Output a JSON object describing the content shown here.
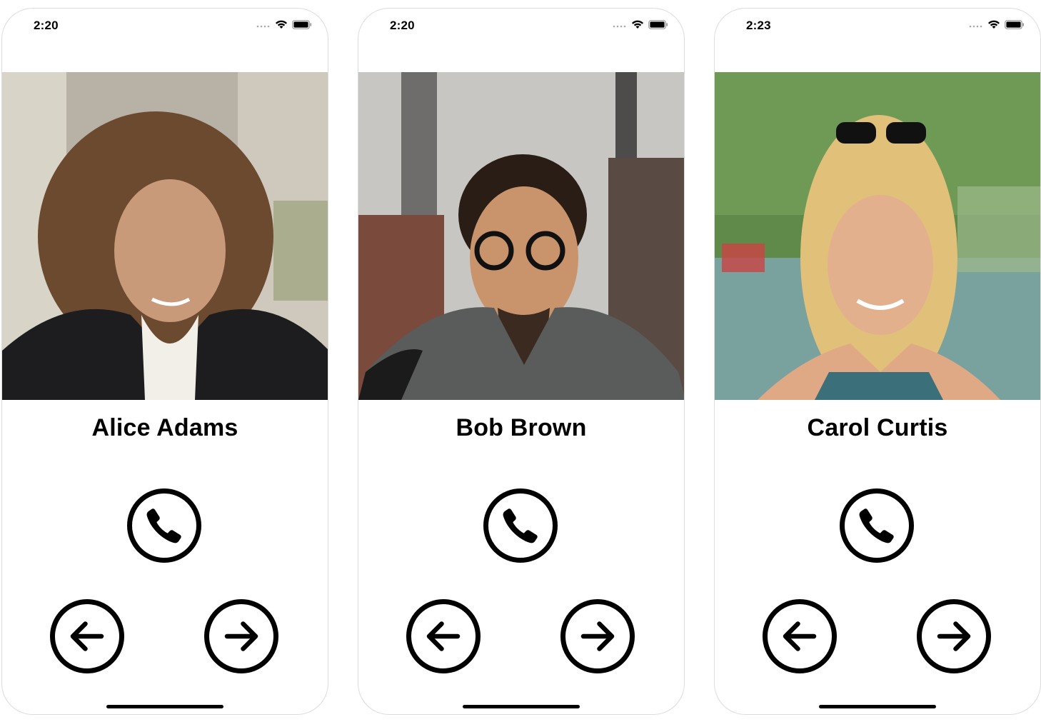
{
  "screens": [
    {
      "status_time": "2:20",
      "contact_name": "Alice Adams",
      "photo_palette": {
        "bg": "#b8b2a6",
        "bg2": "#d9d4c8",
        "skin": "#c99a7a",
        "hair": "#6b4a30",
        "clothing": "#1d1d1f",
        "accent": "#f2efe9"
      }
    },
    {
      "status_time": "2:20",
      "contact_name": "Bob Brown",
      "photo_palette": {
        "bg": "#8f8c87",
        "bg2": "#c8c6c3",
        "skin": "#c9946c",
        "hair": "#2a1d16",
        "clothing": "#595c5a",
        "accent": "#7a4a3c"
      }
    },
    {
      "status_time": "2:23",
      "contact_name": "Carol Curtis",
      "photo_palette": {
        "bg": "#5f8a4a",
        "bg2": "#9db98a",
        "skin": "#e3b08e",
        "hair": "#e1c07a",
        "clothing": "#3b6f7a",
        "accent": "#7fa7b3"
      }
    }
  ],
  "icons": {
    "call": "phone-icon",
    "previous": "arrow-left-icon",
    "next": "arrow-right-icon",
    "signal": "cellular-signal-icon",
    "wifi": "wifi-icon",
    "battery": "battery-icon"
  }
}
